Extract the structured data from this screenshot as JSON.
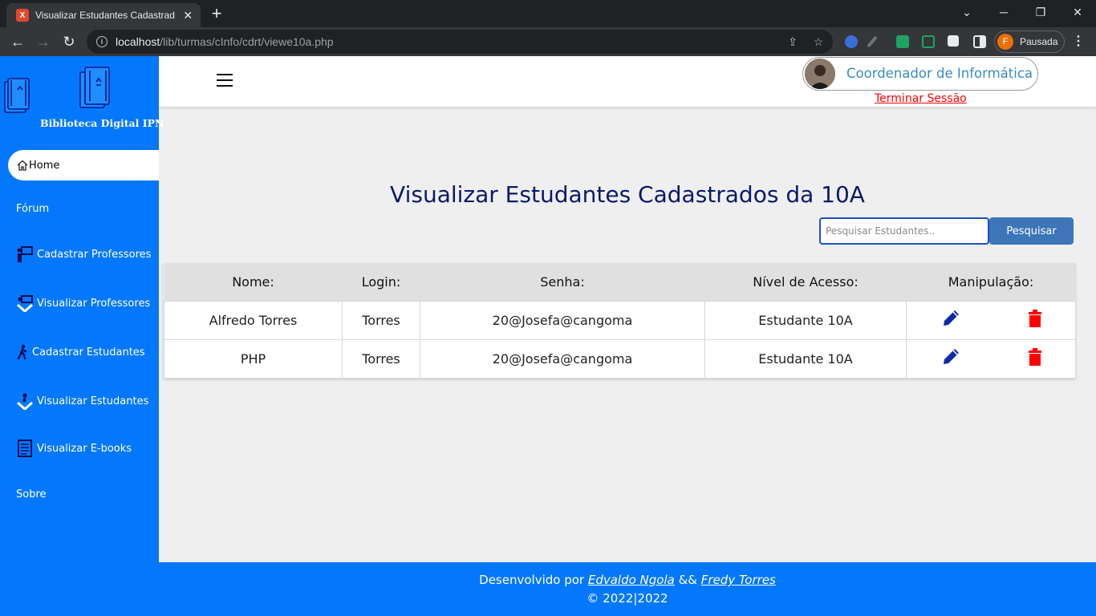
{
  "browser": {
    "tab_title": "Visualizar Estudantes Cadastrados",
    "tab_favicon_text": "X",
    "url_host": "localhost",
    "url_path": "/lib/turmas/cInfo/cdrt/viewe10a.php",
    "profile_initial": "F",
    "profile_label": "Pausada"
  },
  "sidebar": {
    "logo_text": "Biblioteca Digital IPN",
    "items": [
      {
        "label": "Home",
        "icon": "home-icon"
      },
      {
        "label": "Fórum",
        "icon": ""
      },
      {
        "label": "Cadastrar Professores",
        "icon": "teacher-board-icon"
      },
      {
        "label": "Visualizar Professores",
        "icon": "teacher-view-icon"
      },
      {
        "label": "Cadastrar Estudantes",
        "icon": "walking-person-icon"
      },
      {
        "label": "Visualizar Estudantes",
        "icon": "person-view-icon"
      },
      {
        "label": "Visualizar E-books",
        "icon": "ebook-icon"
      },
      {
        "label": "Sobre",
        "icon": ""
      }
    ]
  },
  "header": {
    "user_name": "Coordenador de Informática",
    "logout_label": "Terminar Sessão"
  },
  "main": {
    "title": "Visualizar Estudantes Cadastrados da 10A",
    "search_placeholder": "Pesquisar Estudantes..",
    "search_button": "Pesquisar",
    "columns": [
      "Nome:",
      "Login:",
      "Senha:",
      "Nível de Acesso:",
      "Manipulação:"
    ],
    "rows": [
      {
        "nome": "Alfredo Torres",
        "login": "Torres",
        "senha": "20@Josefa@cangoma",
        "nivel": "Estudante 10A"
      },
      {
        "nome": "PHP",
        "login": "Torres",
        "senha": "20@Josefa@cangoma",
        "nivel": "Estudante 10A"
      }
    ]
  },
  "footer": {
    "prefix": "Desenvolvido por ",
    "author1": "Edvaldo Ngola",
    "separator": " && ",
    "author2": "Fredy Torres",
    "copyright": "© 2022|2022"
  },
  "colors": {
    "sidebar_bg": "#0478fc",
    "title_color": "#0a1a6b",
    "edit_icon": "#0d2aa8",
    "delete_icon": "#ff0000",
    "logout": "#ff0000"
  }
}
